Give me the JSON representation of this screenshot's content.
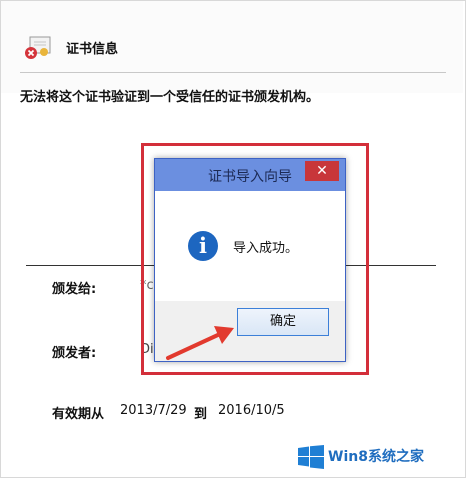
{
  "cert_panel": {
    "title": "证书信息",
    "warning": "无法将这个证书验证到一个受信任的证书颁发机构。",
    "issued_to_label": "颁发给:",
    "issued_to_value": "*c",
    "issued_by_label": "颁发者:",
    "issued_by_value": "Di",
    "valid_from_label": "有效期从",
    "valid_from": "2013/7/29",
    "valid_to_word": "到",
    "valid_to": "2016/10/5"
  },
  "dialog": {
    "title": "证书导入向导",
    "close_symbol": "✕",
    "info_symbol": "i",
    "message": "导入成功。",
    "ok_label": "确定"
  },
  "watermark": {
    "brand": "Win8系统之家"
  },
  "colors": {
    "highlight": "#d32f3a",
    "titlebar": "#6b8fe0",
    "close": "#c8363a",
    "info": "#1d66c0",
    "brand": "#1f6dbf"
  }
}
